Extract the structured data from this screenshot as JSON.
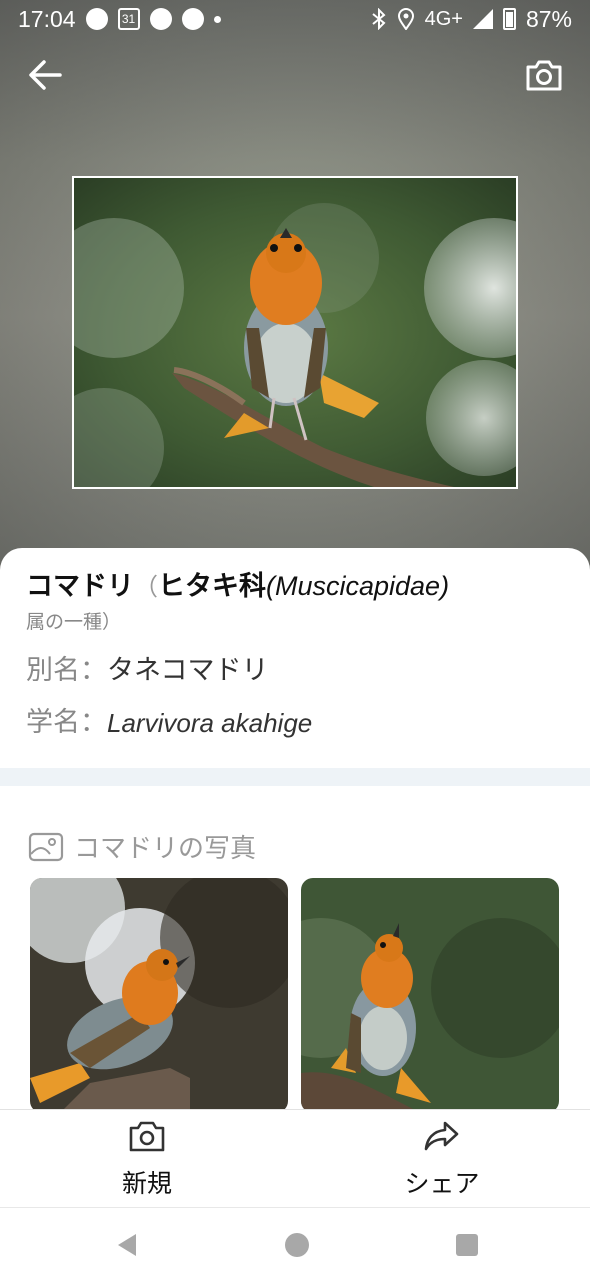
{
  "status_bar": {
    "time": "17:04",
    "calendar_day": "31",
    "network": "4G+",
    "battery": "87%"
  },
  "header": {
    "back_icon": "arrow-left-icon",
    "camera_icon": "camera-icon"
  },
  "species": {
    "name": "コマドリ",
    "paren_open": "（",
    "family_ja": "ヒタキ科",
    "family_latin": "(Muscicapidae)",
    "genus_suffix": "属の一種）",
    "alias_label": "別名：",
    "alias_value": "タネコマドリ",
    "scientific_label": "学名：",
    "scientific_value": "Larvivora akahige"
  },
  "photos": {
    "header_icon": "image-icon",
    "header_label": "コマドリの写真"
  },
  "actions": {
    "new_label": "新規",
    "new_icon": "camera-icon",
    "share_label": "シェア",
    "share_icon": "share-arrow-icon"
  },
  "nav": {
    "back": "triangle-back-icon",
    "home": "circle-home-icon",
    "recents": "square-recents-icon"
  },
  "colors": {
    "robin_orange": "#e2801f",
    "divider": "#eef3f7",
    "muted_text": "#888888"
  }
}
